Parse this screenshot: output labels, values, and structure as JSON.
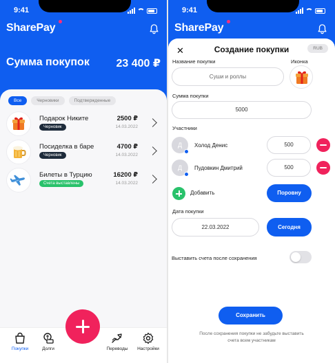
{
  "colors": {
    "primary": "#0f5ef0",
    "accent": "#f0225c",
    "success": "#29c26b",
    "logo_dot": "#ff2d7a"
  },
  "status_bar": {
    "time": "9:41"
  },
  "app": {
    "name": "SharePay"
  },
  "list_screen": {
    "summary": {
      "label": "Сумма покупок",
      "value": "23 400 ₽"
    },
    "filters": [
      {
        "label": "Все",
        "active": true
      },
      {
        "label": "Черновики",
        "active": false
      },
      {
        "label": "Подтвержденные",
        "active": false
      }
    ],
    "purchases": [
      {
        "title": "Подарок Никите",
        "badge": "Черновик",
        "badge_style": "dark",
        "amount": "2500 ₽",
        "date": "14.03.2022",
        "icon": "gift-icon"
      },
      {
        "title": "Посиделка в баре",
        "badge": "Черновик",
        "badge_style": "dark",
        "amount": "4700 ₽",
        "date": "14.03.2022",
        "icon": "beer-icon"
      },
      {
        "title": "Билеты в Турцию",
        "badge": "Счета выставлены",
        "badge_style": "green",
        "amount": "16200 ₽",
        "date": "14.03.2022",
        "icon": "airplane-icon"
      }
    ],
    "tabs": [
      {
        "label": "Покупки",
        "icon": "shopping-bag-icon",
        "active": true
      },
      {
        "label": "Долги",
        "icon": "debts-icon",
        "active": false
      },
      {
        "label": "Переводы",
        "icon": "transfers-icon",
        "active": false
      },
      {
        "label": "Настройки",
        "icon": "gear-icon",
        "active": false
      }
    ]
  },
  "create_screen": {
    "title": "Создание покупки",
    "currency": "RUB",
    "name_label": "Название покупки",
    "name_placeholder": "Суши и роллы",
    "icon_label": "Иконка",
    "amount_label": "Сумма покупки",
    "amount_value": "5000",
    "participants_label": "Участники",
    "participants": [
      {
        "initial": "Д",
        "name": "Холод Денис",
        "amount": "500"
      },
      {
        "initial": "Д",
        "name": "Пудовкин Дмитрий",
        "amount": "500"
      }
    ],
    "add_label": "Добавить",
    "split_equally_label": "Поровну",
    "date_label": "Дата покупки",
    "date_value": "22.03.2022",
    "today_label": "Сегодня",
    "invoice_toggle_label": "Выставить счета после сохранения",
    "invoice_toggle_on": false,
    "save_label": "Сохранить",
    "hint": "После сохранения покупки не забудьте выставить счета всем участникам"
  }
}
